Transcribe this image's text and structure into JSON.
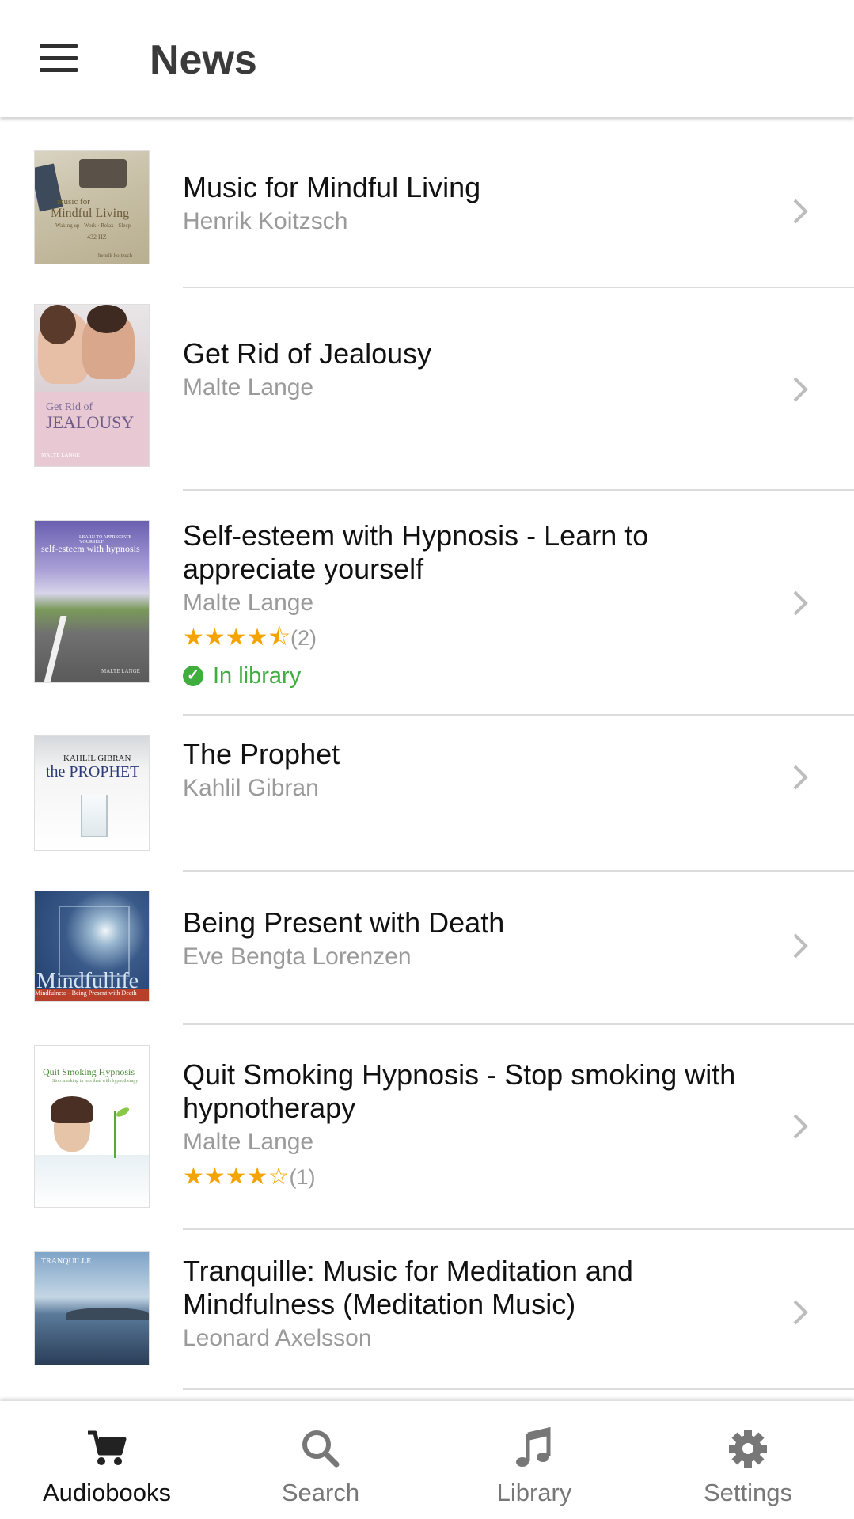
{
  "header": {
    "title": "News",
    "menu_icon": "hamburger-menu-icon"
  },
  "items": [
    {
      "title": "Music for Mindful Living",
      "author": "Henrik Koitzsch",
      "cover": {
        "lines": [
          "music for",
          "Mindful Living",
          "Waking up · Work · Relax · Sleep",
          "432 HZ",
          "henrik koitzsch"
        ]
      }
    },
    {
      "title": "Get Rid of Jealousy",
      "author": "Malte Lange",
      "cover": {
        "lines": [
          "Get Rid of",
          "JEALOUSY",
          "MALTE LANGE"
        ]
      }
    },
    {
      "title": "Self-esteem with Hypnosis - Learn to appreciate yourself",
      "author": "Malte Lange",
      "stars": "★★★★⯪",
      "rating_count": "(2)",
      "status": "In library",
      "cover": {
        "lines": [
          "LEARN TO APPRECIATE YOURSELF",
          "self-esteem with hypnosis",
          "MALTE LANGE"
        ]
      }
    },
    {
      "title": "The Prophet",
      "author": "Kahlil Gibran",
      "cover": {
        "lines": [
          "KAHLIL GIBRAN",
          "the PROPHET"
        ]
      }
    },
    {
      "title": "Being Present with Death",
      "author": "Eve Bengta Lorenzen",
      "cover": {
        "lines": [
          "Mindfullife",
          "Mindfulness - Being Present with Death"
        ]
      }
    },
    {
      "title": "Quit Smoking Hypnosis - Stop smoking with hypnotherapy",
      "author": "Malte Lange",
      "stars": "★★★★☆",
      "rating_count": "(1)",
      "cover": {
        "lines": [
          "Quit Smoking Hypnosis",
          "Stop smoking in less than with hypnotherapy"
        ]
      }
    },
    {
      "title": "Tranquille: Music for Meditation and Mindfulness (Meditation Music)",
      "author": "Leonard Axelsson",
      "cover": {
        "lines": [
          "TRANQUILLE"
        ]
      }
    }
  ],
  "tabs": [
    {
      "label": "Audiobooks",
      "icon": "cart-icon",
      "active": true
    },
    {
      "label": "Search",
      "icon": "search-icon",
      "active": false
    },
    {
      "label": "Library",
      "icon": "music-note-icon",
      "active": false
    },
    {
      "label": "Settings",
      "icon": "gear-icon",
      "active": false
    }
  ],
  "colors": {
    "accent_star": "#f5a300",
    "in_library": "#3fae3f",
    "secondary_text": "#9a9a9a"
  }
}
